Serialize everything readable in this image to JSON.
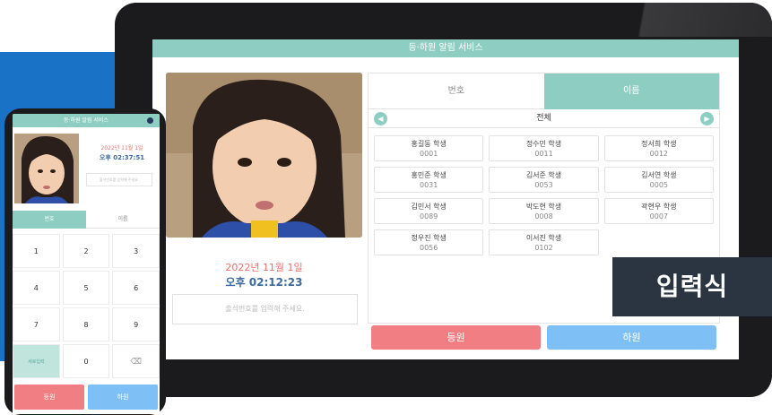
{
  "app": {
    "title": "등·하원 알림 서비스"
  },
  "tablet": {
    "date": "2022년 11월 1일",
    "time": "오후 02:12:23",
    "input_placeholder": "출석번호를 입력해 주세요.",
    "tabs": [
      {
        "label": "번호",
        "active": false
      },
      {
        "label": "이름",
        "active": true
      }
    ],
    "filter_label": "전체",
    "students": [
      {
        "name": "홍길동 학생",
        "id": "0001"
      },
      {
        "name": "정수민 학생",
        "id": "0011"
      },
      {
        "name": "정서희 학생",
        "id": "0012"
      },
      {
        "name": "홍민준 학생",
        "id": "0031"
      },
      {
        "name": "김서준 학생",
        "id": "0053"
      },
      {
        "name": "김서연 학생",
        "id": "0005"
      },
      {
        "name": "김민서 학생",
        "id": "0089"
      },
      {
        "name": "박도현 학생",
        "id": "0008"
      },
      {
        "name": "곽현우 학생",
        "id": "0007"
      },
      {
        "name": "정우진 학생",
        "id": "0056"
      },
      {
        "name": "이서진 학생",
        "id": "0102"
      }
    ],
    "checkin_label": "등원",
    "checkout_label": "하원"
  },
  "badge_label": "입력식",
  "phone": {
    "date": "2022년 11월 1일",
    "time": "오후 02:37:51",
    "input_placeholder": "출석번호를 입력해 주세요.",
    "tabs": [
      {
        "label": "번호",
        "active": true
      },
      {
        "label": "이름",
        "active": false
      }
    ],
    "keys": [
      "1",
      "2",
      "3",
      "4",
      "5",
      "6",
      "7",
      "8",
      "9",
      "새로입력",
      "0",
      "⌫"
    ],
    "checkin_label": "등원",
    "checkout_label": "하원"
  },
  "colors": {
    "accent": "#8ecec2",
    "checkin": "#f07e82",
    "checkout": "#7ec0f5",
    "date": "#e8716d",
    "time": "#3d6aa0",
    "background_block": "#1a72c7"
  }
}
